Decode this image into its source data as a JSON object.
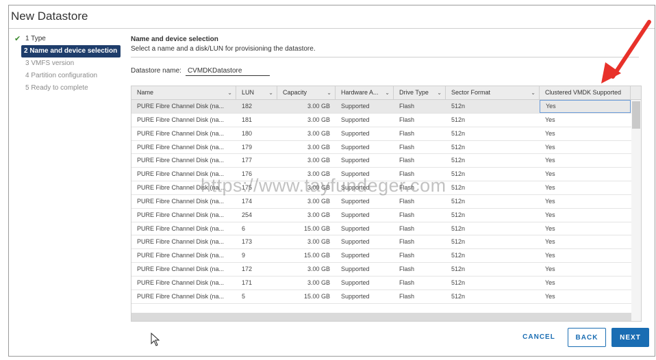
{
  "window": {
    "title": "New Datastore"
  },
  "steps": [
    {
      "label": "1 Type",
      "state": "done"
    },
    {
      "label": "2 Name and device selection",
      "state": "active"
    },
    {
      "label": "3 VMFS version",
      "state": "pending"
    },
    {
      "label": "4 Partition configuration",
      "state": "pending"
    },
    {
      "label": "5 Ready to complete",
      "state": "pending"
    }
  ],
  "section": {
    "title": "Name and device selection",
    "subtitle": "Select a name and a disk/LUN for provisioning the datastore."
  },
  "datastore_name": {
    "label": "Datastore name:",
    "value": "CVMDKDatastore"
  },
  "table": {
    "columns": [
      "Name",
      "LUN",
      "Capacity",
      "Hardware A...",
      "Drive Type",
      "Sector Format",
      "Clustered VMDK Supported"
    ],
    "rows": [
      [
        "PURE Fibre Channel Disk (na...",
        "182",
        "3.00 GB",
        "Supported",
        "Flash",
        "512n",
        "Yes"
      ],
      [
        "PURE Fibre Channel Disk (na...",
        "181",
        "3.00 GB",
        "Supported",
        "Flash",
        "512n",
        "Yes"
      ],
      [
        "PURE Fibre Channel Disk (na...",
        "180",
        "3.00 GB",
        "Supported",
        "Flash",
        "512n",
        "Yes"
      ],
      [
        "PURE Fibre Channel Disk (na...",
        "179",
        "3.00 GB",
        "Supported",
        "Flash",
        "512n",
        "Yes"
      ],
      [
        "PURE Fibre Channel Disk (na...",
        "177",
        "3.00 GB",
        "Supported",
        "Flash",
        "512n",
        "Yes"
      ],
      [
        "PURE Fibre Channel Disk (na...",
        "176",
        "3.00 GB",
        "Supported",
        "Flash",
        "512n",
        "Yes"
      ],
      [
        "PURE Fibre Channel Disk (na...",
        "175",
        "3.00 GB",
        "Supported",
        "Flash",
        "512n",
        "Yes"
      ],
      [
        "PURE Fibre Channel Disk (na...",
        "174",
        "3.00 GB",
        "Supported",
        "Flash",
        "512n",
        "Yes"
      ],
      [
        "PURE Fibre Channel Disk (na...",
        "254",
        "3.00 GB",
        "Supported",
        "Flash",
        "512n",
        "Yes"
      ],
      [
        "PURE Fibre Channel Disk (na...",
        "6",
        "15.00 GB",
        "Supported",
        "Flash",
        "512n",
        "Yes"
      ],
      [
        "PURE Fibre Channel Disk (na...",
        "173",
        "3.00 GB",
        "Supported",
        "Flash",
        "512n",
        "Yes"
      ],
      [
        "PURE Fibre Channel Disk (na...",
        "9",
        "15.00 GB",
        "Supported",
        "Flash",
        "512n",
        "Yes"
      ],
      [
        "PURE Fibre Channel Disk (na...",
        "172",
        "3.00 GB",
        "Supported",
        "Flash",
        "512n",
        "Yes"
      ],
      [
        "PURE Fibre Channel Disk (na...",
        "171",
        "3.00 GB",
        "Supported",
        "Flash",
        "512n",
        "Yes"
      ],
      [
        "PURE Fibre Channel Disk (na...",
        "5",
        "15.00 GB",
        "Supported",
        "Flash",
        "512n",
        "Yes"
      ]
    ]
  },
  "buttons": {
    "cancel": "CANCEL",
    "back": "BACK",
    "next": "NEXT"
  },
  "watermark": "https://www.tayfundeger.com",
  "icons": {
    "check": "check-icon",
    "chevron": "chevron-down-icon",
    "arrow": "red-annotation-arrow",
    "cursor": "mouse-pointer-icon"
  },
  "colors": {
    "accent": "#1a6db3",
    "active_step": "#1e3d6b",
    "check": "#3c8a2e",
    "annotation": "#e8312a"
  }
}
